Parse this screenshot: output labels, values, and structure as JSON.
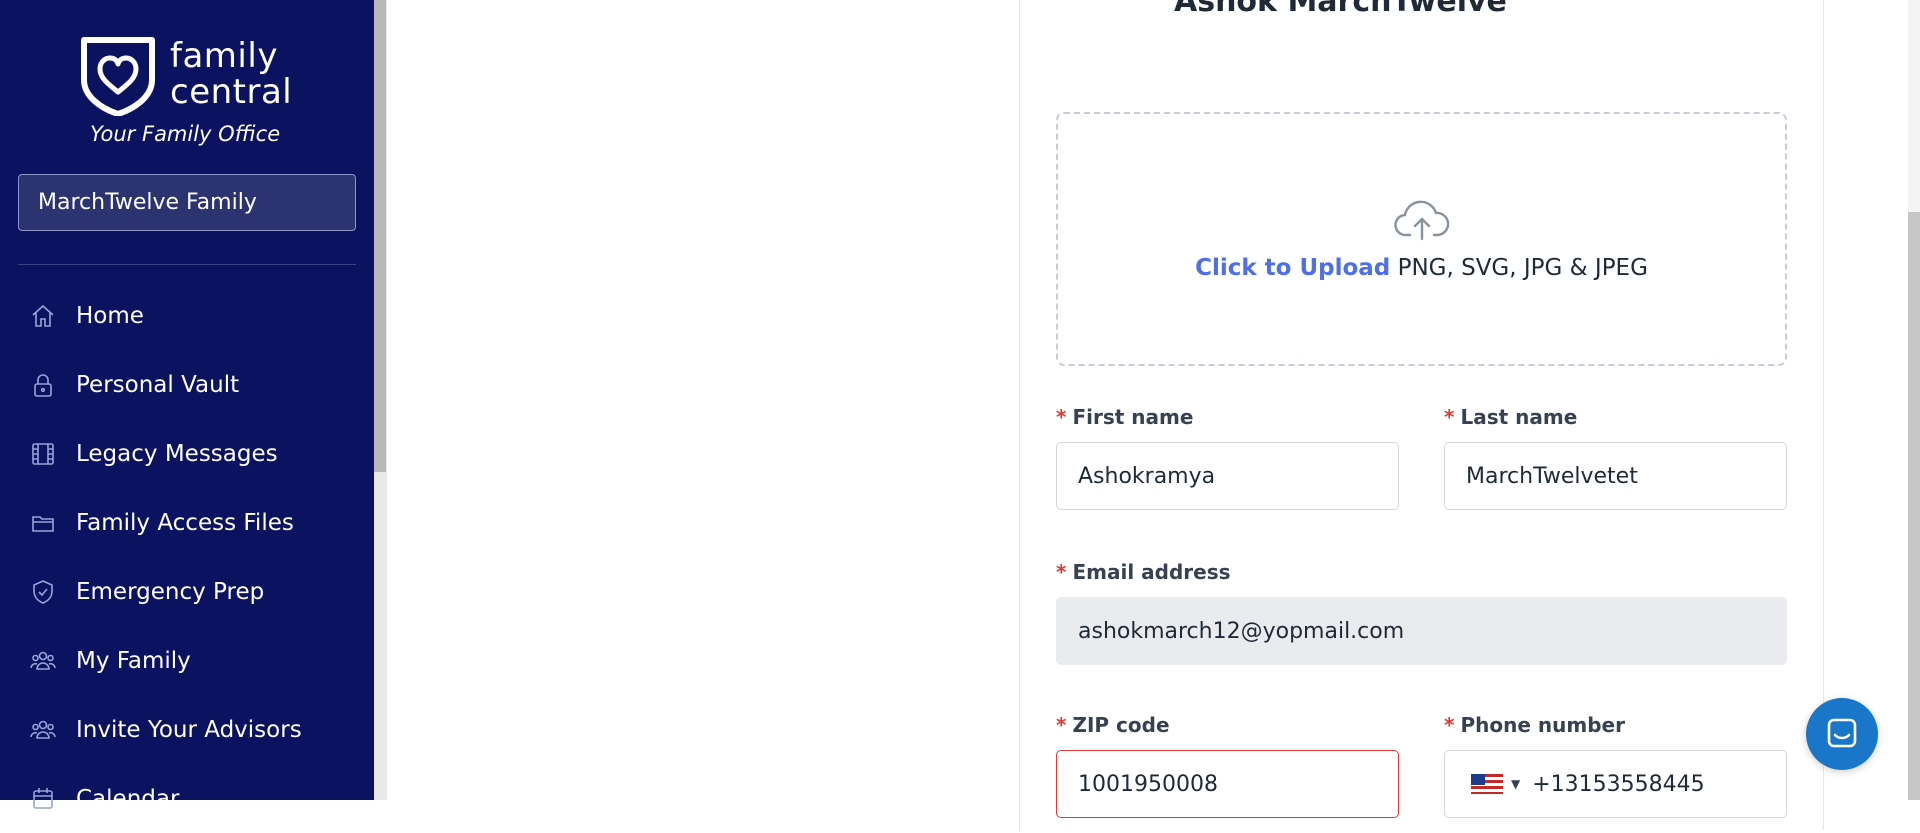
{
  "brand": {
    "name_line1": "family",
    "name_line2": "central",
    "tagline": "Your Family Office"
  },
  "family_selector": {
    "value": "MarchTwelve Family"
  },
  "sidebar": {
    "items": [
      {
        "label": "Home",
        "icon": "home-icon"
      },
      {
        "label": "Personal Vault",
        "icon": "lock-icon"
      },
      {
        "label": "Legacy Messages",
        "icon": "film-icon"
      },
      {
        "label": "Family Access Files",
        "icon": "folder-icon"
      },
      {
        "label": "Emergency Prep",
        "icon": "shield-check-icon"
      },
      {
        "label": "My Family",
        "icon": "users-icon"
      },
      {
        "label": "Invite Your Advisors",
        "icon": "users-icon"
      },
      {
        "label": "Calendar",
        "icon": "calendar-icon"
      }
    ]
  },
  "profile": {
    "partial_title": "Ashok MarchTwelve"
  },
  "upload": {
    "link_text": "Click to Upload",
    "formats_text": " PNG, SVG, JPG & JPEG"
  },
  "form": {
    "required_mark": "*",
    "first_name": {
      "label": "First name",
      "value": "Ashokramya"
    },
    "last_name": {
      "label": "Last name",
      "value": "MarchTwelvetet"
    },
    "email": {
      "label": "Email address",
      "value": "ashokmarch12@yopmail.com"
    },
    "zip": {
      "label": "ZIP code",
      "value": "1001950008"
    },
    "phone": {
      "label": "Phone number",
      "value": "+13153558445",
      "country": "us-flag-icon"
    }
  },
  "colors": {
    "sidebar_bg": "#0b1260",
    "accent_link": "#4f6ee8",
    "required": "#e53935",
    "chat_button": "#1976c8"
  }
}
